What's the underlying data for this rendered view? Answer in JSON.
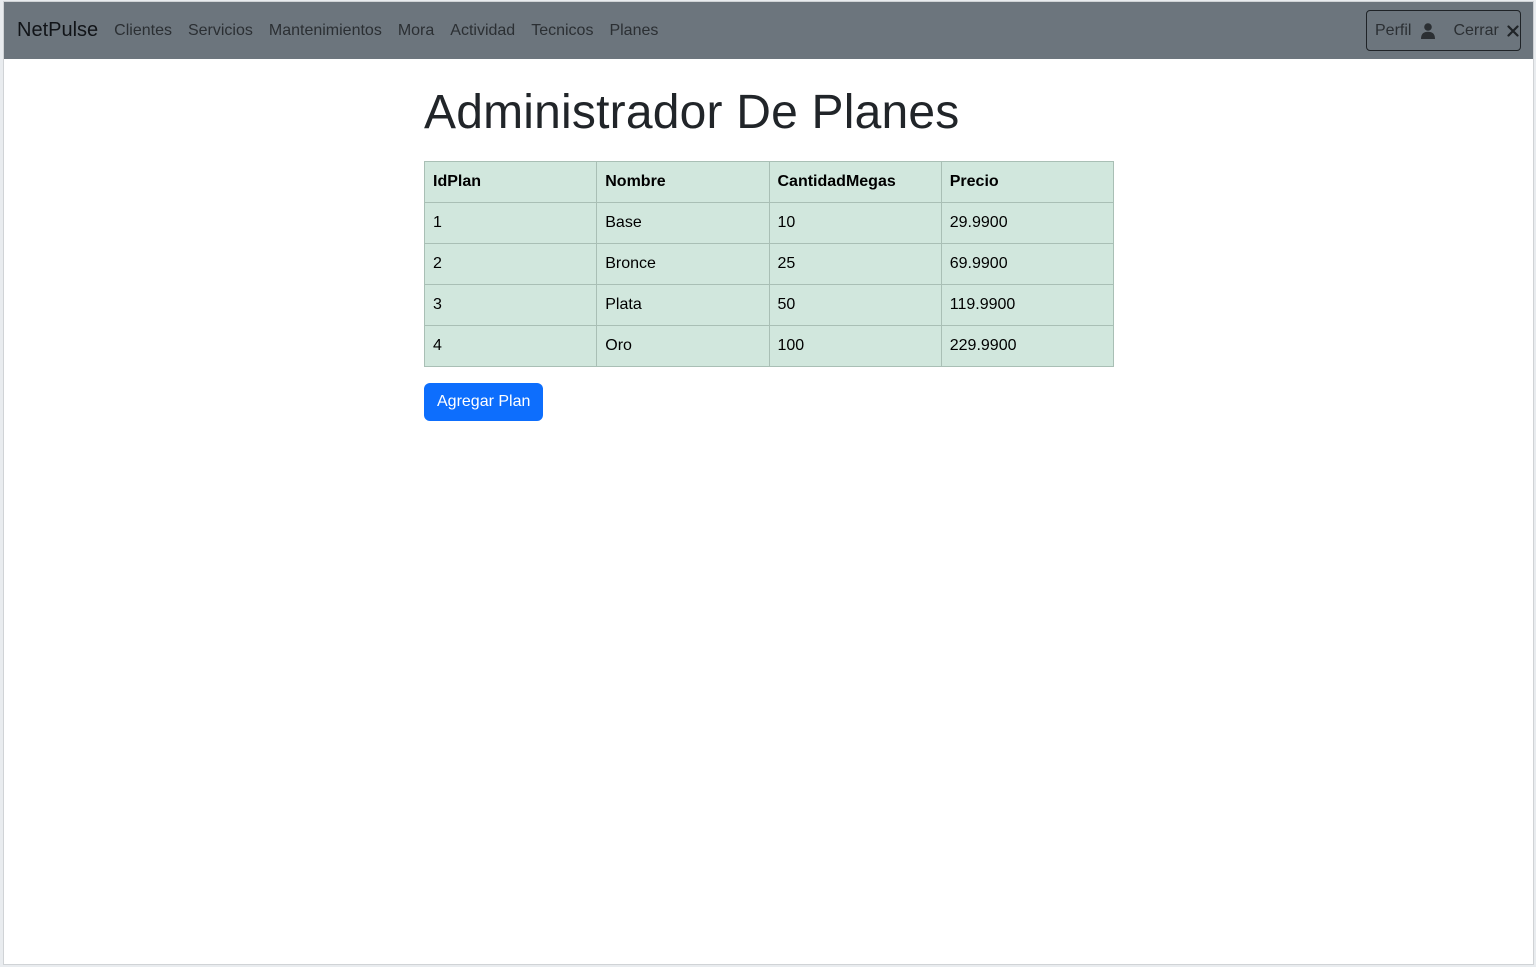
{
  "navbar": {
    "brand": "NetPulse",
    "links": [
      "Clientes",
      "Servicios",
      "Mantenimientos",
      "Mora",
      "Actividad",
      "Tecnicos",
      "Planes"
    ],
    "profile_label": "Perfil",
    "logout_label": "Cerrar",
    "profile_icon": "user-icon",
    "logout_icon": "close-icon"
  },
  "main": {
    "title": "Administrador De Planes",
    "table": {
      "headers": [
        "IdPlan",
        "Nombre",
        "CantidadMegas",
        "Precio"
      ],
      "rows": [
        [
          "1",
          "Base",
          "10",
          "29.9900"
        ],
        [
          "2",
          "Bronce",
          "25",
          "69.9900"
        ],
        [
          "3",
          "Plata",
          "50",
          "119.9900"
        ],
        [
          "4",
          "Oro",
          "100",
          "229.9900"
        ]
      ]
    },
    "add_button": "Agregar Plan"
  },
  "colors": {
    "navbar_bg": "#6c757d",
    "table_bg": "#d1e7dd",
    "primary": "#0d6efd"
  }
}
